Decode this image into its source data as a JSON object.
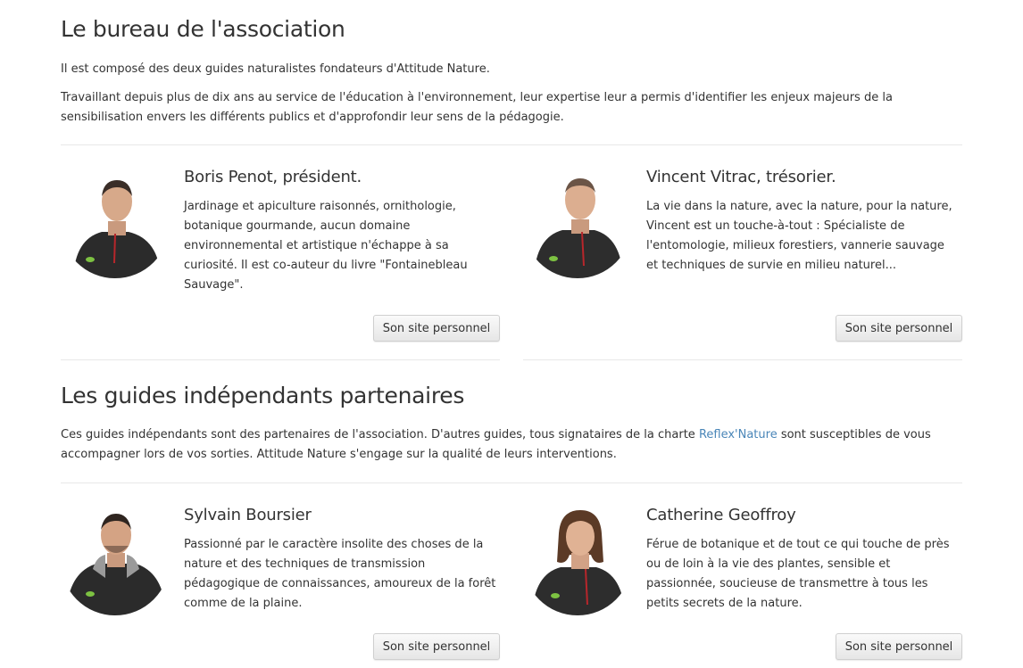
{
  "bureau": {
    "title": "Le bureau de l'association",
    "intro": "Il est composé des deux guides naturalistes fondateurs d'Attitude Nature.",
    "text": "Travaillant depuis plus de dix ans au service de l'éducation à l'environnement, leur expertise leur a permis d'identifier les enjeux majeurs de la sensibilisation envers les différents publics et d'approfondir leur sens de la pédagogie.",
    "members": [
      {
        "name": "Boris Penot, président.",
        "bio": "Jardinage et apiculture raisonnés, ornithologie, botanique gourmande, aucun domaine environnemental et artistique n'échappe à sa curiosité. Il est co-auteur du livre \"Fontainebleau Sauvage\".",
        "button": "Son site personnel"
      },
      {
        "name": "Vincent Vitrac, trésorier.",
        "bio": "La vie dans la nature, avec la nature, pour la nature, Vincent est un touche-à-tout : Spécialiste de l'entomologie, milieux forestiers, vannerie sauvage et techniques de survie en milieu naturel...",
        "button": "Son site personnel"
      }
    ]
  },
  "guides": {
    "title": "Les guides indépendants partenaires",
    "text_before_link": "Ces guides indépendants sont des partenaires de l'association. D'autres guides, tous signataires de la charte ",
    "link": "Reflex'Nature",
    "text_after_link": " sont susceptibles de vous accompagner lors de vos sorties. Attitude Nature s'engage sur la qualité de leurs interventions.",
    "members": [
      {
        "name": "Sylvain Boursier",
        "bio": "Passionné par le caractère insolite des choses de la nature et des techniques de transmission pédagogique de connaissances, amoureux de la forêt comme de la plaine.",
        "button": "Son site personnel"
      },
      {
        "name": "Catherine Geoffroy",
        "bio": "Férue de botanique et de tout ce qui touche de près ou de loin à la vie des plantes, sensible et passionnée, soucieuse de transmettre à tous les petits secrets de la nature.",
        "button": "Son site personnel"
      }
    ]
  },
  "colors": {
    "link": "#4a86b8",
    "text": "#333333",
    "jacket": "#2b2b2b",
    "logo_green": "#7dc242"
  }
}
